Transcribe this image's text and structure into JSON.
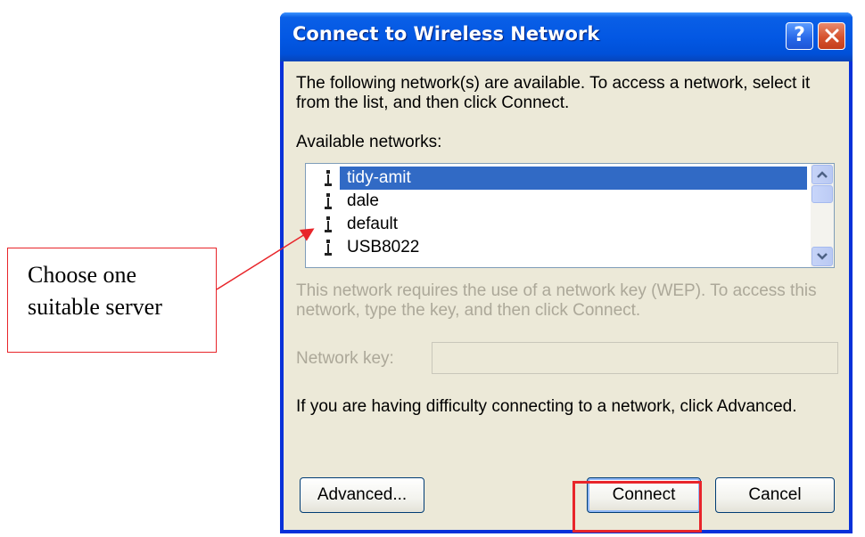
{
  "dialog": {
    "title": "Connect to Wireless Network",
    "help_label": "?",
    "close_label": "✕",
    "intro": "The following network(s) are available. To access a network, select it from the list, and then click Connect.",
    "available_label": "Available networks:",
    "networks": [
      {
        "name": "tidy-amit",
        "selected": true
      },
      {
        "name": "dale",
        "selected": false
      },
      {
        "name": "default",
        "selected": false
      },
      {
        "name": "USB8022",
        "selected": false
      }
    ],
    "wep_text": "This network requires the use of a network key (WEP). To access this network, type the key, and then click Connect.",
    "network_key_label": "Network key:",
    "network_key_value": "",
    "difficulty_text": "If you are having difficulty connecting to a network, click Advanced.",
    "buttons": {
      "advanced": "Advanced...",
      "connect": "Connect",
      "cancel": "Cancel"
    }
  },
  "annotation": {
    "line1": "Choose one",
    "line2": "suitable server"
  },
  "colors": {
    "accent_red": "#e8252a",
    "selection": "#316ac5",
    "titlebar": "#0358e4"
  },
  "icons": {
    "network": "wireless-network-icon",
    "scroll_up": "scroll-up-arrow-icon",
    "scroll_down": "scroll-down-arrow-icon"
  }
}
